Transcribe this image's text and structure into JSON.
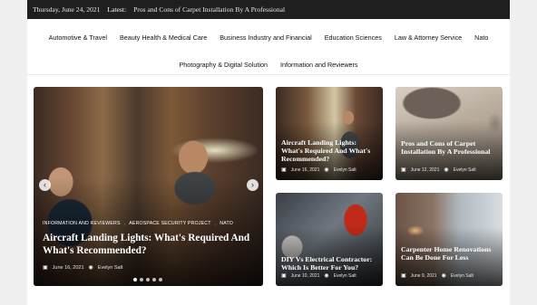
{
  "topbar": {
    "date": "Thursday, June 24, 2021",
    "latest_label": "Latest:",
    "latest_headline": "Pros and Cons of Carpet Installation By A Professional"
  },
  "nav": {
    "row1": [
      "Automotive & Travel",
      "Beauty Health & Medical Care",
      "Business Industry and Financial",
      "Education Sciences",
      "Law & Attorney Service",
      "Nato"
    ],
    "row2": [
      "Photography & Digital Solution",
      "Information and Reviewers"
    ]
  },
  "hero": {
    "categories": [
      "INFORMATION AND REVIEWERS",
      "AEROSPACE SECURITY PROJECT",
      "NATO"
    ],
    "title": "Aircraft Landing Lights: What's Required And What's Recommended?",
    "date": "June 16, 2021",
    "author": "Evelyn Salt",
    "slides": 5,
    "active_slide": 1
  },
  "cards": [
    {
      "title": "Aircraft Landing Lights: What's Required And What's Recommended?",
      "date": "June 16, 2021",
      "author": "Evelyn Salt"
    },
    {
      "title": "Pros and Cons of Carpet Installation By A Professional",
      "date": "June 12, 2021",
      "author": "Evelyn Salt"
    },
    {
      "title": "DIY Vs Electrical Contractor: Which Is Better For You?",
      "date": "June 10, 2021",
      "author": "Evelyn Salt"
    },
    {
      "title": "Carpenter Home Renovations Can Be Done For Less",
      "date": "June 9, 2021",
      "author": "Evelyn Salt"
    }
  ],
  "icons": {
    "calendar": "calendar-icon",
    "author": "user-circle-icon",
    "prev": "chevron-left-icon",
    "next": "chevron-right-icon"
  }
}
